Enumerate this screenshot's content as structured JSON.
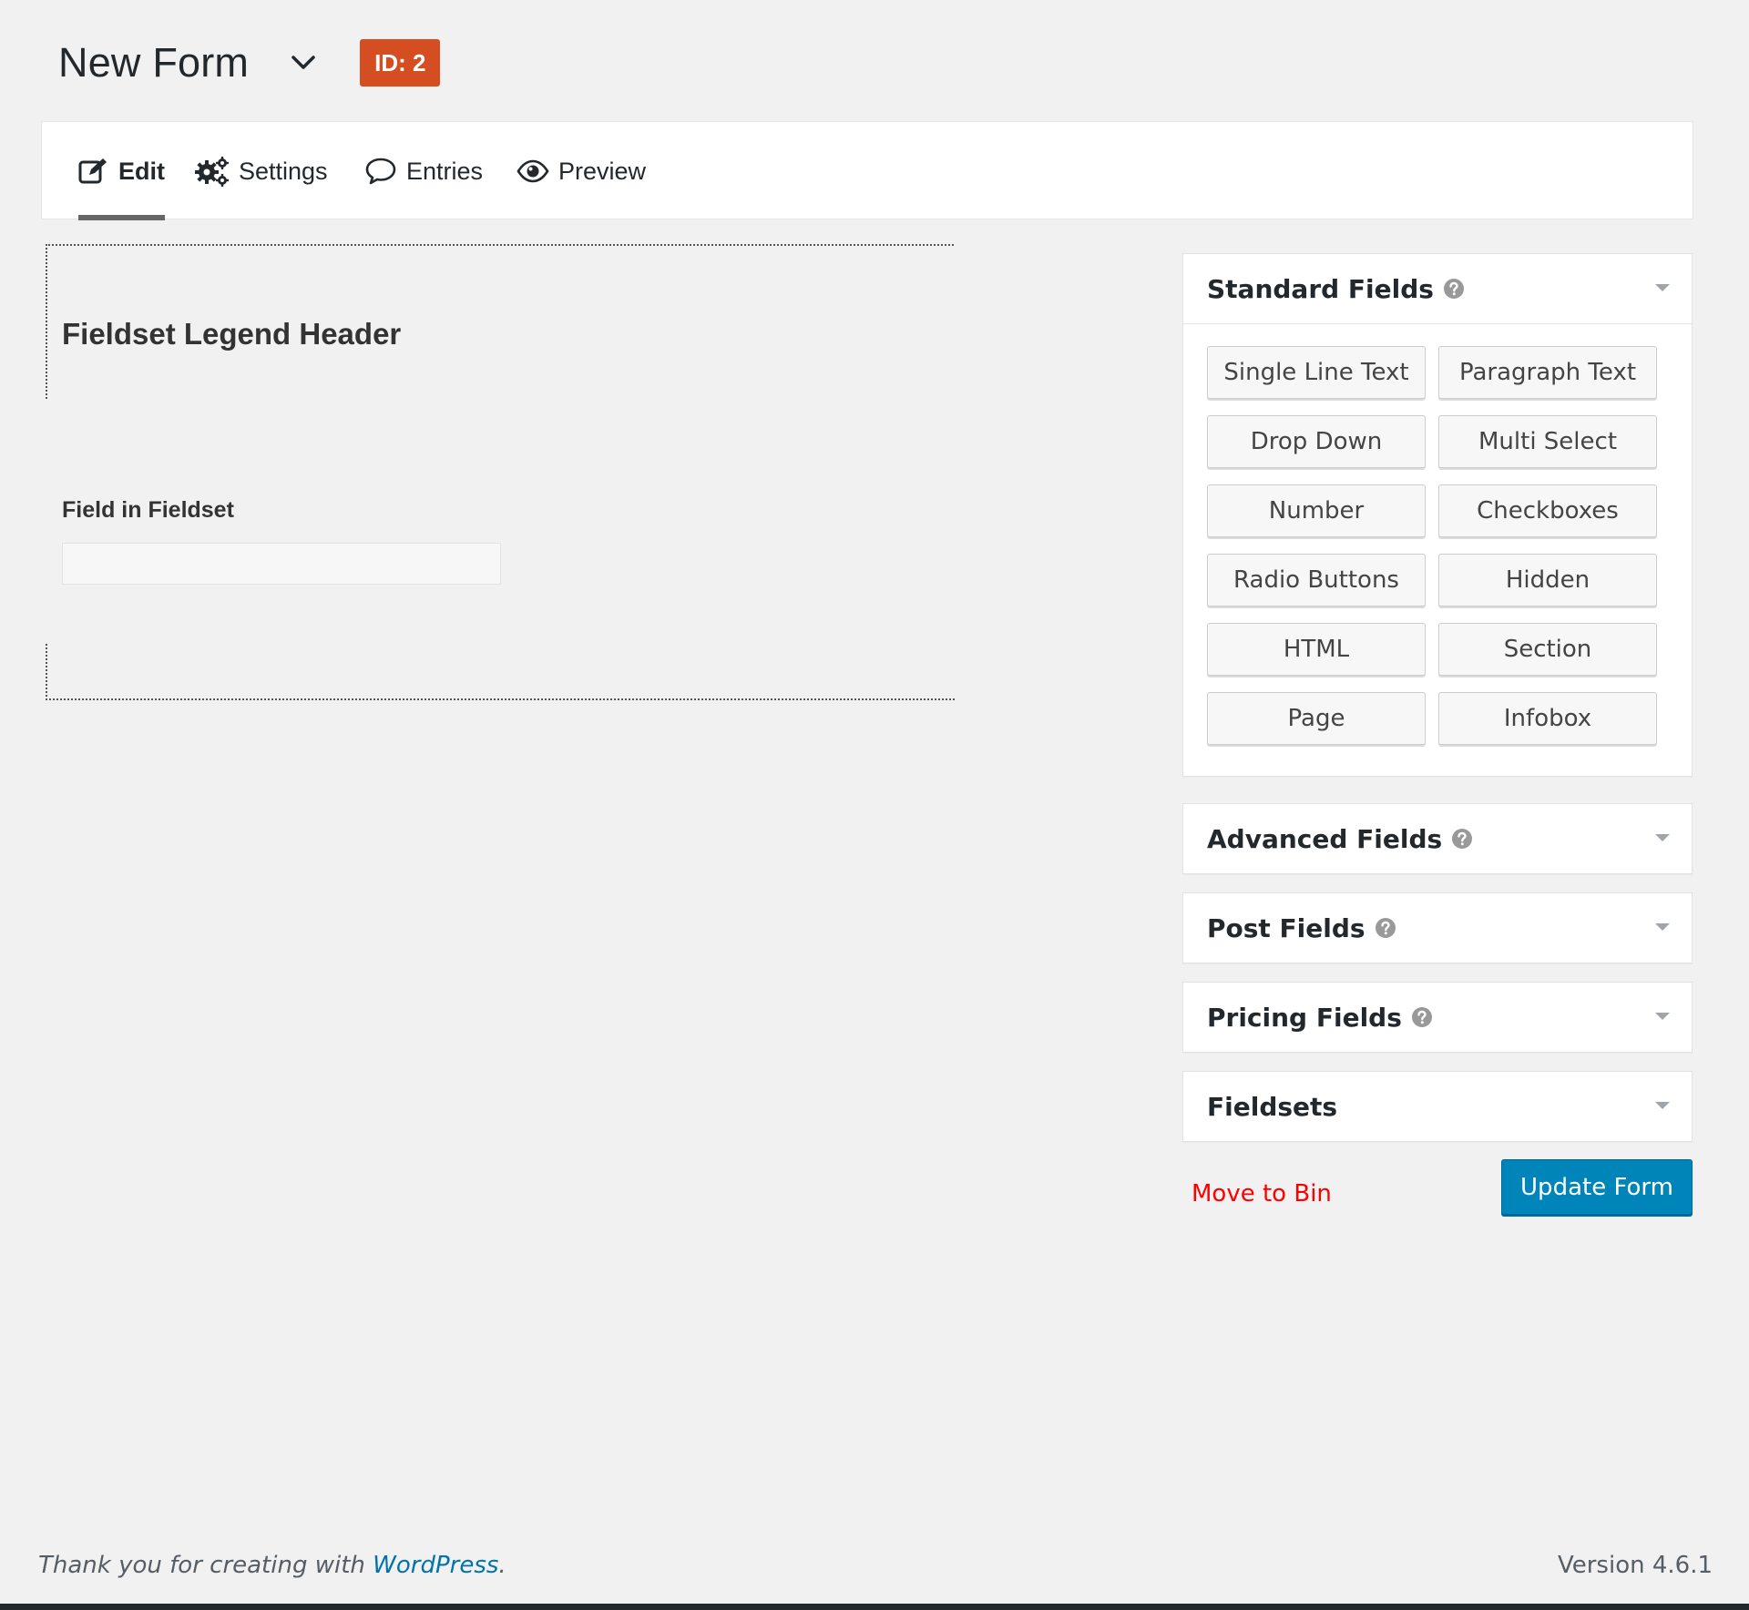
{
  "header": {
    "form_title": "New Form",
    "id_badge": "ID: 2",
    "badge_color": "#d54e21"
  },
  "tabs": [
    {
      "label": "Edit",
      "icon": "edit-icon",
      "active": true
    },
    {
      "label": "Settings",
      "icon": "gears-icon",
      "active": false
    },
    {
      "label": "Entries",
      "icon": "comment-icon",
      "active": false
    },
    {
      "label": "Preview",
      "icon": "eye-icon",
      "active": false
    }
  ],
  "canvas": {
    "legend": "Fieldset Legend Header",
    "field_label": "Field in Fieldset",
    "field_value": ""
  },
  "panels": {
    "standard": {
      "title": "Standard Fields",
      "buttons": [
        "Single Line Text",
        "Paragraph Text",
        "Drop Down",
        "Multi Select",
        "Number",
        "Checkboxes",
        "Radio Buttons",
        "Hidden",
        "HTML",
        "Section",
        "Page",
        "Infobox"
      ]
    },
    "advanced": {
      "title": "Advanced Fields"
    },
    "post": {
      "title": "Post Fields"
    },
    "pricing": {
      "title": "Pricing Fields"
    },
    "fieldsets": {
      "title": "Fieldsets"
    }
  },
  "actions": {
    "move_to_bin": "Move to Bin",
    "update_form": "Update Form",
    "primary_color": "#0085ba",
    "danger_color": "#ff0000"
  },
  "footer": {
    "thanks_prefix": "Thank you for creating with ",
    "thanks_link": "WordPress",
    "thanks_suffix": ".",
    "version": "Version 4.6.1"
  }
}
